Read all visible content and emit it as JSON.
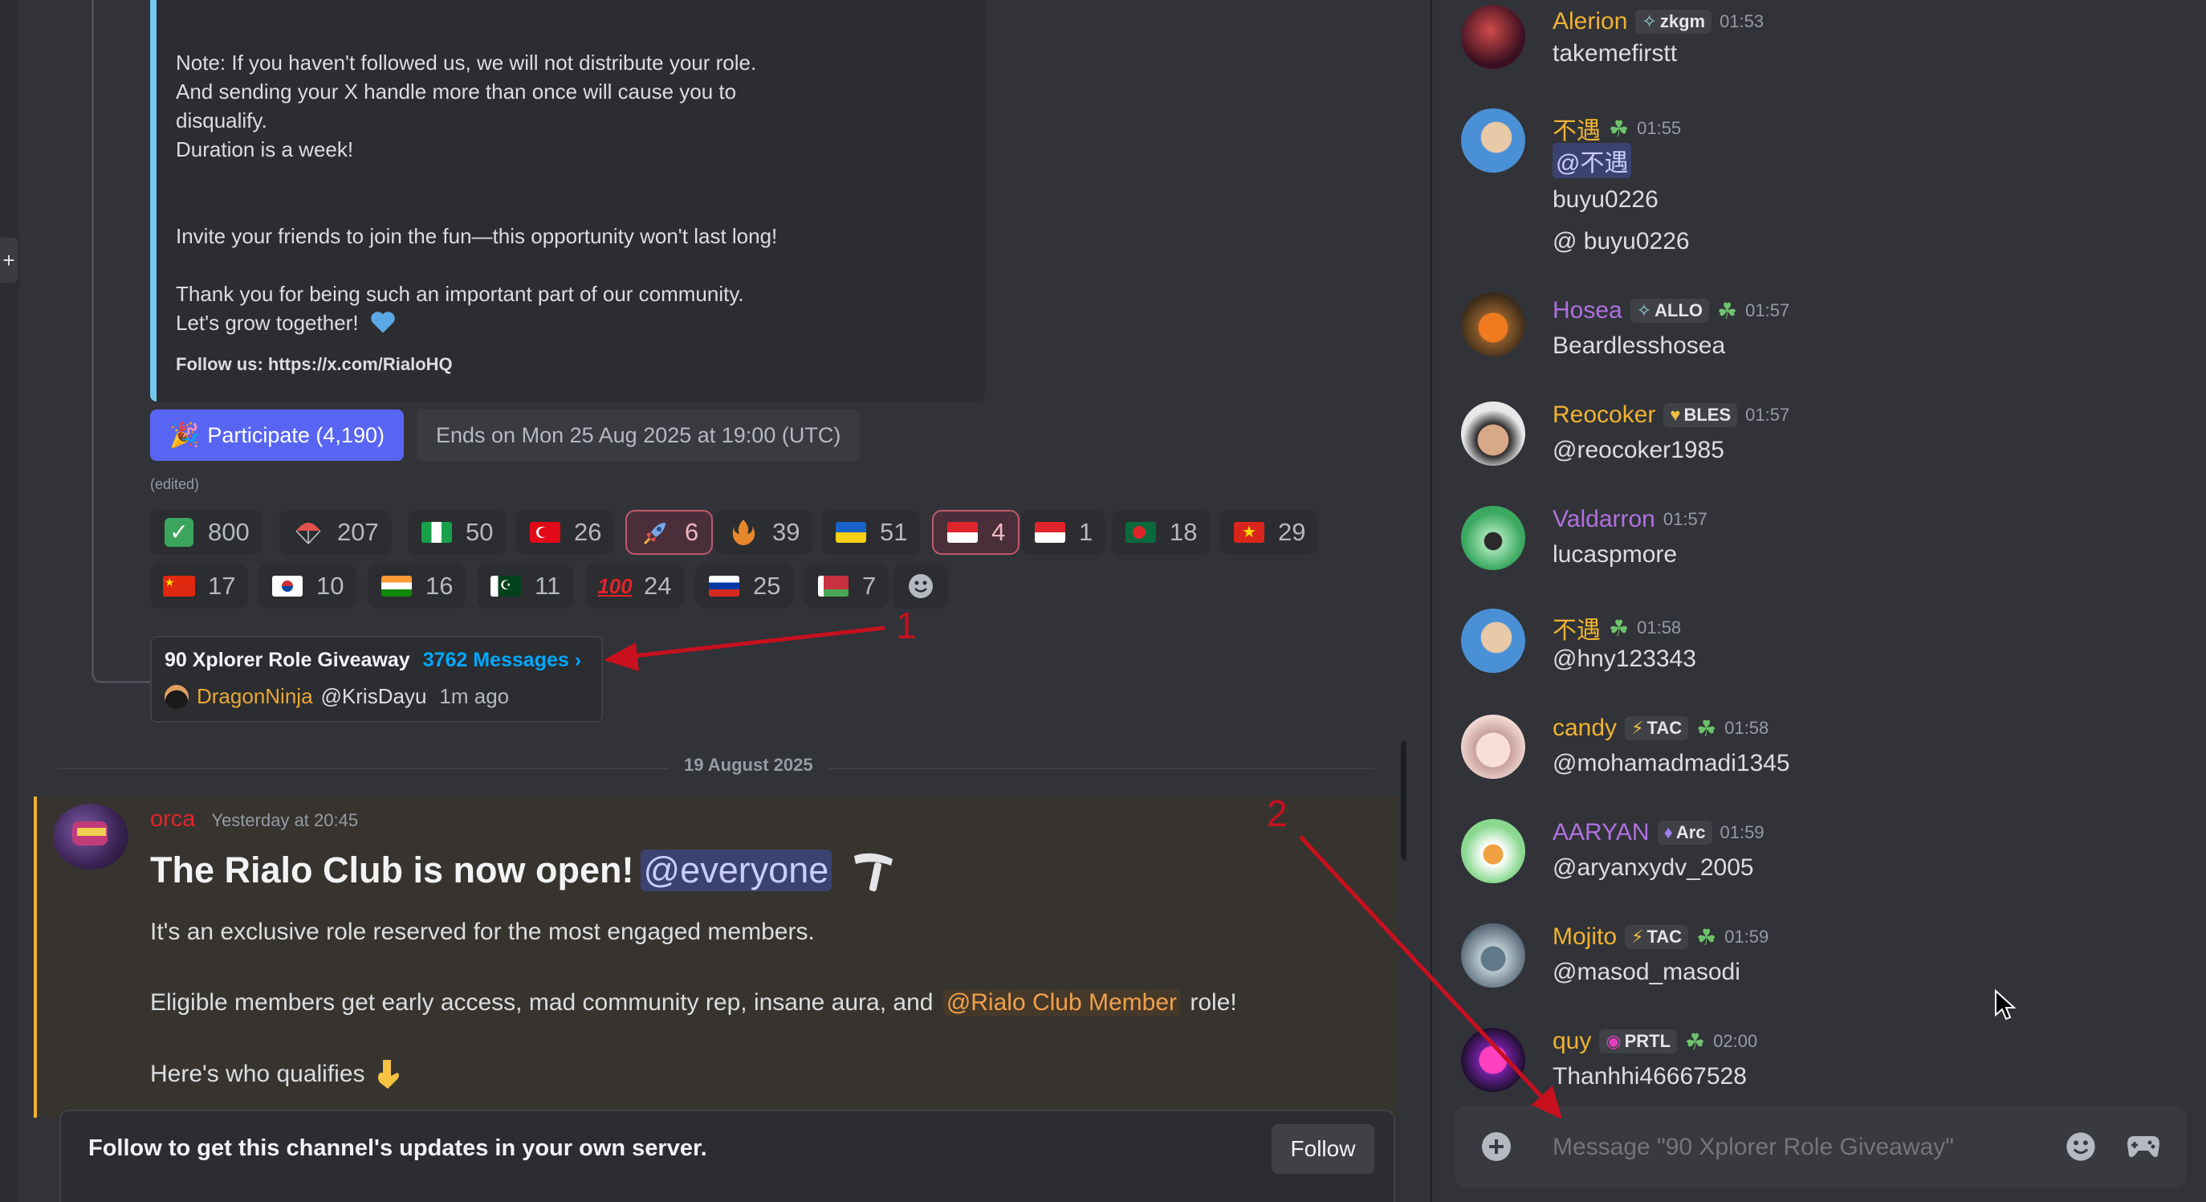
{
  "embed": {
    "note_lines": [
      "Note: If you haven't followed us, we will not distribute your role.",
      "And sending your X handle more than once will cause you to",
      "disqualify.",
      "Duration is a week!"
    ],
    "invite": "Invite your friends to join the fun—this opportunity won't last long!",
    "thanks": "Thank you for being such an important part of our community.",
    "grow": "Let's grow together!",
    "follow_us": "Follow us: https://x.com/RialoHQ"
  },
  "giveaway": {
    "participate_label": "Participate (4,190)",
    "ends_text": "Ends on Mon 25 Aug 2025 at 19:00 (UTC)",
    "edited": "(edited)"
  },
  "reactions": [
    {
      "emoji": "check",
      "count": "800"
    },
    {
      "emoji": "parachute",
      "count": "207"
    },
    {
      "emoji": "flag-nigeria",
      "count": "50"
    },
    {
      "emoji": "flag-turkey",
      "count": "26"
    },
    {
      "emoji": "rocket",
      "count": "6",
      "active": true
    },
    {
      "emoji": "flame-emblem",
      "count": "39"
    },
    {
      "emoji": "flag-ukraine",
      "count": "51"
    },
    {
      "emoji": "flag-indonesia",
      "count": "4",
      "active": true
    },
    {
      "emoji": "flag-indonesia",
      "count": "1"
    },
    {
      "emoji": "flag-bangladesh",
      "count": "18"
    },
    {
      "emoji": "flag-vietnam",
      "count": "29"
    },
    {
      "emoji": "flag-china",
      "count": "17"
    },
    {
      "emoji": "flag-korea",
      "count": "10"
    },
    {
      "emoji": "flag-india",
      "count": "16"
    },
    {
      "emoji": "flag-pakistan",
      "count": "11"
    },
    {
      "emoji": "hundred",
      "count": "24"
    },
    {
      "emoji": "flag-russia",
      "count": "25"
    },
    {
      "emoji": "flag-belarus",
      "count": "7"
    }
  ],
  "thread_card": {
    "title": "90 Xplorer Role Giveaway",
    "count": "3762 Messages ›",
    "author": "DragonNinja",
    "handle": "@KrisDayu",
    "time": "1m ago"
  },
  "annotations": {
    "one": "1",
    "two": "2"
  },
  "date_divider": "19 August 2025",
  "announcement": {
    "author": "orca",
    "time": "Yesterday at 20:45",
    "heading": "The Rialo Club is now open!",
    "mention": "@everyone",
    "line1": "It's an exclusive role reserved for the most engaged members.",
    "line2_pre": "Eligible members get early access, mad community rep, insane aura, and",
    "line2_mention": "@Rialo Club Member",
    "line2_post": "role!",
    "line3": "Here's who qualifies"
  },
  "follow_notice": {
    "text": "Follow to get this channel's updates in your own server.",
    "button": "Follow"
  },
  "thread_messages": [
    {
      "name": "Alerion",
      "color": "#f0b232",
      "tag": "zkgm",
      "tag_icon": "sparkle",
      "leaf": false,
      "time": "01:53",
      "lines": [
        "takemefirstt"
      ]
    },
    {
      "name": "不遇",
      "color": "#f0b232",
      "tag": "",
      "leaf": true,
      "time": "01:55",
      "mention": "@不遇",
      "lines": [
        "buyu0226",
        "@ buyu0226"
      ]
    },
    {
      "name": "Hosea",
      "color": "#b070e0",
      "tag": "ALLO",
      "tag_icon": "sparkle",
      "leaf": true,
      "time": "01:57",
      "lines": [
        "Beardlesshosea"
      ]
    },
    {
      "name": "Reocoker",
      "color": "#f0b232",
      "tag": "BLES",
      "tag_icon": "heart",
      "leaf": false,
      "time": "01:57",
      "lines": [
        "@reocoker1985"
      ]
    },
    {
      "name": "Valdarron",
      "color": "#b070e0",
      "tag": "",
      "leaf": false,
      "time": "01:57",
      "lines": [
        "lucaspmore"
      ]
    },
    {
      "name": "不遇",
      "color": "#f0b232",
      "tag": "",
      "leaf": true,
      "time": "01:58",
      "lines": [
        "@hny123343"
      ]
    },
    {
      "name": "candy",
      "color": "#f0b232",
      "tag": "TAC",
      "tag_icon": "bolt",
      "leaf": true,
      "time": "01:58",
      "lines": [
        "@mohamadmadi1345"
      ]
    },
    {
      "name": "AARYAN",
      "color": "#b070e0",
      "tag": "Arc",
      "tag_icon": "flame",
      "leaf": false,
      "time": "01:59",
      "lines": [
        "@aryanxydv_2005"
      ]
    },
    {
      "name": "Mojito",
      "color": "#f0b232",
      "tag": "TAC",
      "tag_icon": "bolt",
      "leaf": true,
      "time": "01:59",
      "lines": [
        "@masod_masodi"
      ]
    },
    {
      "name": "quy",
      "color": "#f0b232",
      "tag": "PRTL",
      "tag_icon": "ring",
      "leaf": true,
      "time": "02:00",
      "lines": [
        "Thanhhi46667528"
      ]
    }
  ],
  "composer": {
    "placeholder": "Message \"90 Xplorer Role Giveaway\""
  },
  "colors": {
    "accent": "#5865f2",
    "annotation": "#c8101e",
    "mention_bg": "#3c4270",
    "mention_fg": "#c9cdfb",
    "role_mention": "#f0a04b"
  }
}
